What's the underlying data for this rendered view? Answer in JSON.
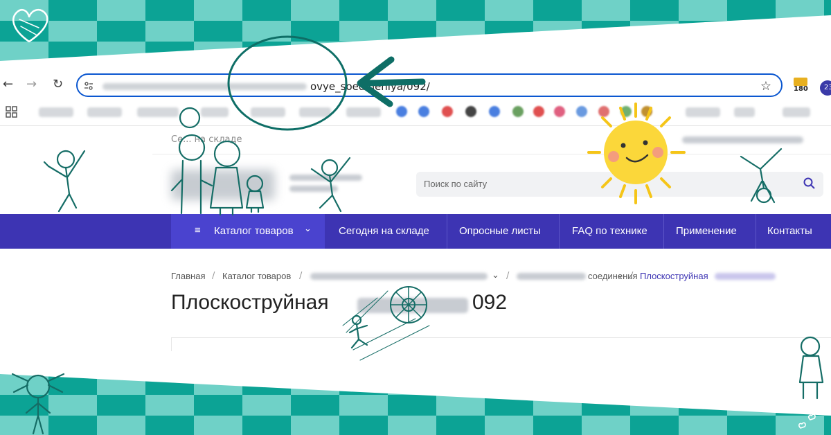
{
  "browser": {
    "url_visible": "ovye_soedineniya/092/",
    "extension_badge_1": "180",
    "extension_badge_2": "23"
  },
  "site": {
    "topstrip_visible": "Се... на складе",
    "search": {
      "placeholder": "Поиск по сайту"
    },
    "nav": {
      "catalog": "Каталог товаров",
      "items": [
        "Сегодня на складе",
        "Опросные листы",
        "FAQ по технике",
        "Применение",
        "Контакты"
      ]
    },
    "breadcrumb": {
      "home": "Главная",
      "catalog": "Каталог товаров",
      "section_partial": "соединения",
      "current_partial": "Плоскоструйная"
    },
    "title_start": "Плоскоструйная",
    "title_end": "092"
  },
  "colors": {
    "teal": "#0ca395",
    "teal_light": "#6fd1c7",
    "nav_bg": "#3d34b3",
    "nav_active": "#4a43cf",
    "omnibox_border": "#0b57d0",
    "sketch": "#156d66"
  }
}
